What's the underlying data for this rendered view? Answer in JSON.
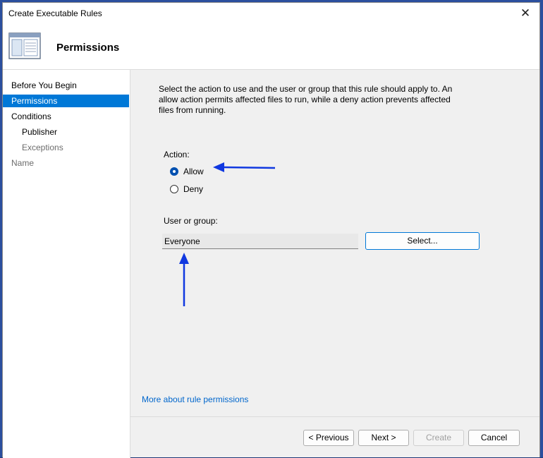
{
  "window": {
    "title": "Create Executable Rules"
  },
  "header": {
    "title": "Permissions",
    "icon": "wizard-window-icon"
  },
  "nav": {
    "items": [
      {
        "label": "Before You Begin",
        "state": "normal"
      },
      {
        "label": "Permissions",
        "state": "selected"
      },
      {
        "label": "Conditions",
        "state": "normal"
      },
      {
        "label": "Publisher",
        "state": "normal"
      },
      {
        "label": "Exceptions",
        "state": "muted"
      },
      {
        "label": "Name",
        "state": "muted"
      }
    ]
  },
  "content": {
    "description": "Select the action to use and the user or group that this rule should apply to. An allow action permits affected files to run, while a deny action prevents affected files from running.",
    "action_label": "Action:",
    "options": [
      {
        "label": "Allow",
        "checked": true
      },
      {
        "label": "Deny",
        "checked": false
      }
    ],
    "user_group_label": "User or group:",
    "user_group_value": "Everyone",
    "select_button": "Select...",
    "more_link": "More about rule permissions"
  },
  "footer": {
    "previous": "< Previous",
    "next": "Next >",
    "create": "Create",
    "cancel": "Cancel"
  },
  "colors": {
    "selection": "#0078d7",
    "link": "#0066cc",
    "annotation_arrow": "#1038e0"
  }
}
